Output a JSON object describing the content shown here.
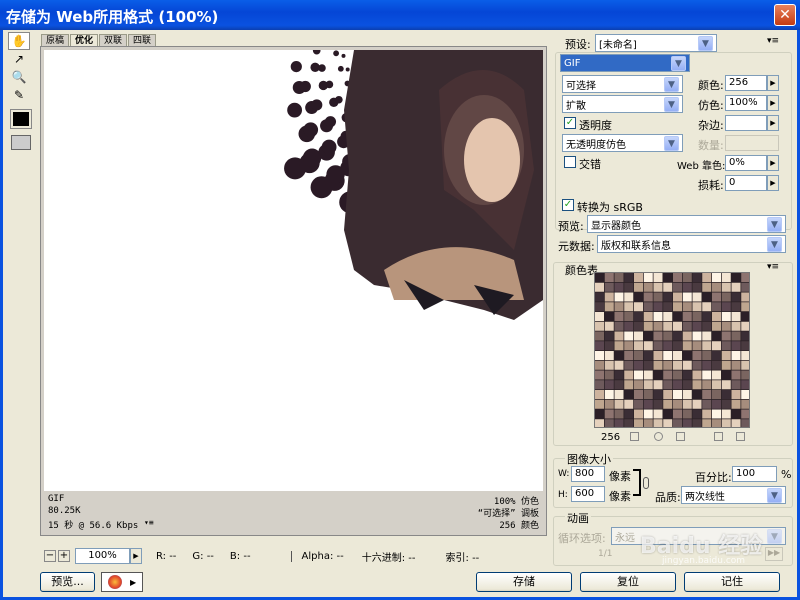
{
  "window": {
    "title": "存储为 Web所用格式 (100%)",
    "close_glyph": "✕"
  },
  "tabs": [
    {
      "label": "原稿"
    },
    {
      "label": "优化"
    },
    {
      "label": "双联"
    },
    {
      "label": "四联"
    }
  ],
  "tools": [
    {
      "icon": "hand-icon",
      "glyph": "✋"
    },
    {
      "icon": "slice-select-icon",
      "glyph": "↗"
    },
    {
      "icon": "zoom-icon",
      "glyph": "🔍"
    },
    {
      "icon": "eyedropper-icon",
      "glyph": "✎"
    }
  ],
  "canvas_status": {
    "format": "GIF",
    "size": "80.25K",
    "time": "15 秒 @ 56.6 Kbps",
    "dither": "100% 仿色",
    "palette": "“可选择” 调板",
    "colors": "256 颜色"
  },
  "bottom_bar": {
    "zoom": "100%",
    "r": "R: --",
    "g": "G: --",
    "b": "B: --",
    "alpha": "Alpha: --",
    "hex": "十六进制: --",
    "index": "索引: --"
  },
  "settings": {
    "preset_label": "预设:",
    "preset_value": "[未命名]",
    "format_value": "GIF",
    "reduction_value": "可选择",
    "colors_label": "颜色:",
    "colors_value": "256",
    "dither_algo_value": "扩散",
    "dither_label": "仿色:",
    "dither_value": "100%",
    "transparency_label": "透明度",
    "matte_label": "杂边:",
    "trans_dither_value": "无透明度仿色",
    "amount_label": "数量:",
    "interlaced_label": "交错",
    "web_snap_label": "Web 靠色:",
    "web_snap_value": "0%",
    "lossy_label": "损耗:",
    "lossy_value": "0",
    "srgb_label": "转换为 sRGB",
    "preview_label": "预览:",
    "preview_value": "显示器颜色",
    "metadata_label": "元数据:",
    "metadata_value": "版权和联系信息"
  },
  "color_table": {
    "title": "颜色表",
    "count": "256"
  },
  "image_size": {
    "title": "图像大小",
    "w_label": "W:",
    "w_value": "800",
    "h_label": "H:",
    "h_value": "600",
    "unit": "像素",
    "percent_label": "百分比:",
    "percent_value": "100",
    "percent_unit": "%",
    "quality_label": "品质:",
    "quality_value": "两次线性"
  },
  "animation": {
    "title": "动画",
    "loop_label": "循环选项:",
    "loop_value": "永远",
    "frame": "1/1"
  },
  "buttons": {
    "preview": "预览...",
    "save": "存储",
    "reset": "复位",
    "remember": "记住"
  },
  "watermark": {
    "text": "Baidu 经验",
    "url": "jingyan.baidu.com"
  }
}
